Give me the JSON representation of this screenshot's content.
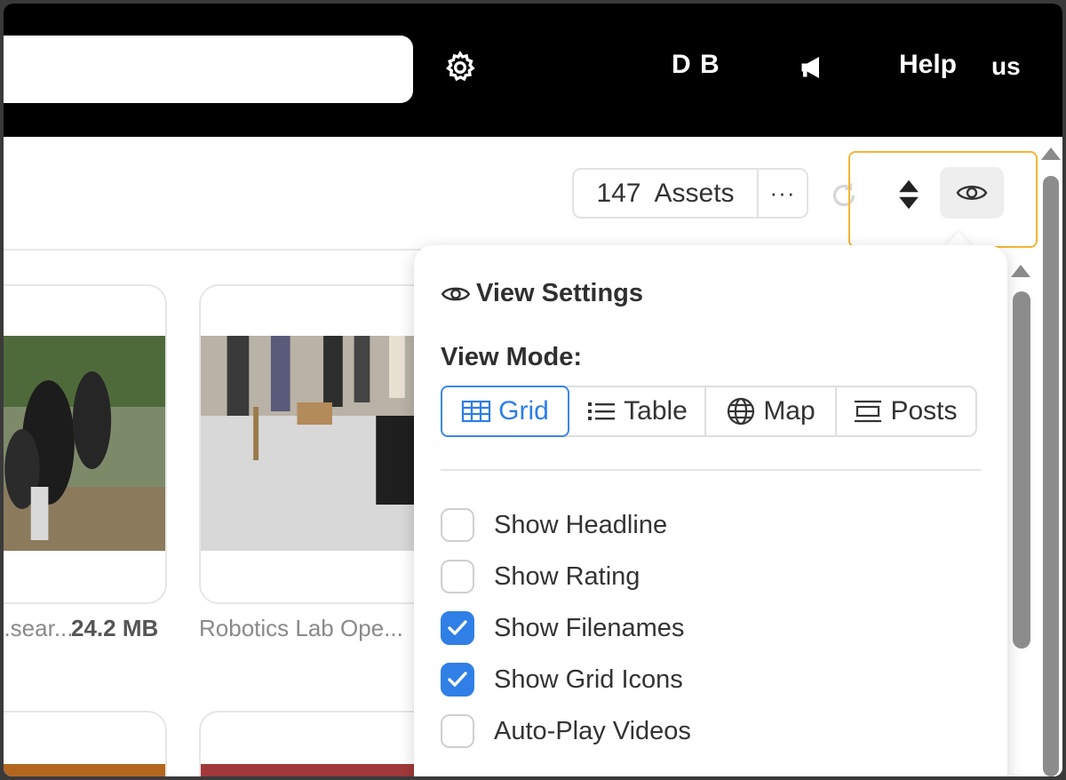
{
  "topbar": {
    "initials": "D B",
    "help_label": "Help",
    "lang_label": "us"
  },
  "toolbar": {
    "asset_count": "147  Assets",
    "more_label": "···"
  },
  "cards": [
    {
      "filename": "...sear...",
      "filesize": "24.2 MB"
    },
    {
      "filename": "Robotics Lab Ope..."
    }
  ],
  "view_settings": {
    "title": "View Settings",
    "mode_label": "View Mode:",
    "modes": [
      {
        "label": "Grid",
        "icon": "grid-icon",
        "active": true
      },
      {
        "label": "Table",
        "icon": "list-icon",
        "active": false
      },
      {
        "label": "Map",
        "icon": "globe-icon",
        "active": false
      },
      {
        "label": "Posts",
        "icon": "posts-icon",
        "active": false
      }
    ],
    "options": [
      {
        "label": "Show Headline",
        "checked": false
      },
      {
        "label": "Show Rating",
        "checked": false
      },
      {
        "label": "Show Filenames",
        "checked": true
      },
      {
        "label": "Show Grid Icons",
        "checked": true
      },
      {
        "label": "Auto-Play Videos",
        "checked": false
      }
    ]
  },
  "colors": {
    "accent": "#2f7fe6",
    "highlight": "#f5b534",
    "topbar": "#000000"
  }
}
